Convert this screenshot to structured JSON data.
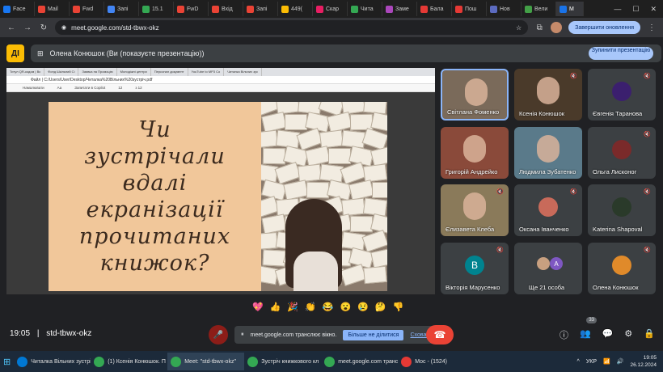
{
  "browser": {
    "tabs": [
      {
        "label": "Face",
        "color": "#1877f2"
      },
      {
        "label": "Mail",
        "color": "#ea4335"
      },
      {
        "label": "Fwd",
        "color": "#ea4335"
      },
      {
        "label": "Запі",
        "color": "#4285f4"
      },
      {
        "label": "15.1",
        "color": "#34a853"
      },
      {
        "label": "FwD",
        "color": "#ea4335"
      },
      {
        "label": "Вхід",
        "color": "#ea4335"
      },
      {
        "label": "Запі",
        "color": "#ea4335"
      },
      {
        "label": "449(",
        "color": "#fbbc04"
      },
      {
        "label": "Скар",
        "color": "#e91e63"
      },
      {
        "label": "Чита",
        "color": "#34a853"
      },
      {
        "label": "Заме",
        "color": "#ab47bc"
      },
      {
        "label": "Бала",
        "color": "#e53935"
      },
      {
        "label": "Пош",
        "color": "#e53935"
      },
      {
        "label": "Нов",
        "color": "#5c6bc0"
      },
      {
        "label": "Вели",
        "color": "#43a047"
      },
      {
        "label": "М",
        "color": "#1a73e8",
        "active": true
      }
    ],
    "url": "meet.google.com/std-tbwx-okz",
    "update_label": "Завершити оновлення"
  },
  "meet": {
    "logo_text": "ДІ",
    "presenting_text": "Олена Конюшок (Ви (показуєте презентацію))",
    "stop_label": "Зупинити презентацію",
    "meeting_code": "std-tbwx-okz",
    "time": "19:05"
  },
  "shared": {
    "inner_tabs": [
      "Титул QR-кодом | Вс",
      "Фонд Шкільний Сі",
      "Заявка на Промоцію",
      "Молодіжні центри",
      "Персонал документ",
      "YouTube to MP3 Co",
      "Читалка Вільних зус"
    ],
    "inner_url": "Файл | C:/Users/User/Desktop/Читалка%20Вільних%20зустріч.pdf",
    "toolbar": [
      "Намалювати",
      "Аа",
      "Запитати в Copilot",
      "12",
      "з 12"
    ],
    "slide_lines": [
      "Чи",
      "зустрічали",
      "вдалі",
      "екранізації",
      "прочитаних",
      "книжок?"
    ]
  },
  "participants": [
    {
      "name": "Світлана Фоменко",
      "type": "video",
      "bg": "#7a6a5a",
      "speaker": true
    },
    {
      "name": "Ксенія Конюшок",
      "type": "video",
      "bg": "#4a3a2a",
      "muted": true
    },
    {
      "name": "Євгенія Таранова",
      "type": "avatar",
      "avatar_color": "#3b1f6e",
      "muted": true
    },
    {
      "name": "Григорій Андрейко",
      "type": "video",
      "bg": "#8a4a3a"
    },
    {
      "name": "Людмила Зубатенко",
      "type": "video",
      "bg": "#5a7a8a"
    },
    {
      "name": "Ольга Лисконог",
      "type": "avatar",
      "avatar_color": "#7a2a2a",
      "muted": true
    },
    {
      "name": "Єлизавета Клеба",
      "type": "video",
      "bg": "#8a7a5a",
      "muted": true
    },
    {
      "name": "Оксана Іванченко",
      "type": "avatar",
      "avatar_color": "#c86a5a",
      "muted": true
    },
    {
      "name": "Katerina Shapoval",
      "type": "avatar",
      "avatar_color": "#2a3a2a",
      "muted": true
    },
    {
      "name": "Вікторія Марусенко",
      "type": "letter",
      "letter": "В",
      "avatar_color": "#00838f",
      "muted": true
    },
    {
      "name": "Ще 21 особа",
      "type": "more",
      "letter": "A"
    },
    {
      "name": "Олена Конюшок",
      "type": "avatar",
      "avatar_color": "#e08a2a",
      "muted": true
    }
  ],
  "reactions": [
    "💖",
    "👍",
    "🎉",
    "👏",
    "😂",
    "😮",
    "😢",
    "🤔",
    "👎"
  ],
  "bottom": {
    "share_notice": "meet.google.com транслює вікно.",
    "stop_share_label": "Більше не ділитися",
    "hide_label": "Сховати",
    "people_count": "33"
  },
  "taskbar": {
    "items": [
      {
        "label": "Читалка Вільних зустрі",
        "color": "#0078d4"
      },
      {
        "label": "(1) Ксенія Конюшок. П",
        "color": "#34a853"
      },
      {
        "label": "Meet: \"std-tbwx-okz\"",
        "color": "#34a853",
        "active": true
      },
      {
        "label": "Зустріч книжкового кл",
        "color": "#34a853"
      },
      {
        "label": "meet.google.com трансл",
        "color": "#34a853"
      },
      {
        "label": "Мос - (1524)",
        "color": "#e53935"
      }
    ],
    "lang": "УКР",
    "time": "19:05",
    "date": "26.12.2024"
  }
}
